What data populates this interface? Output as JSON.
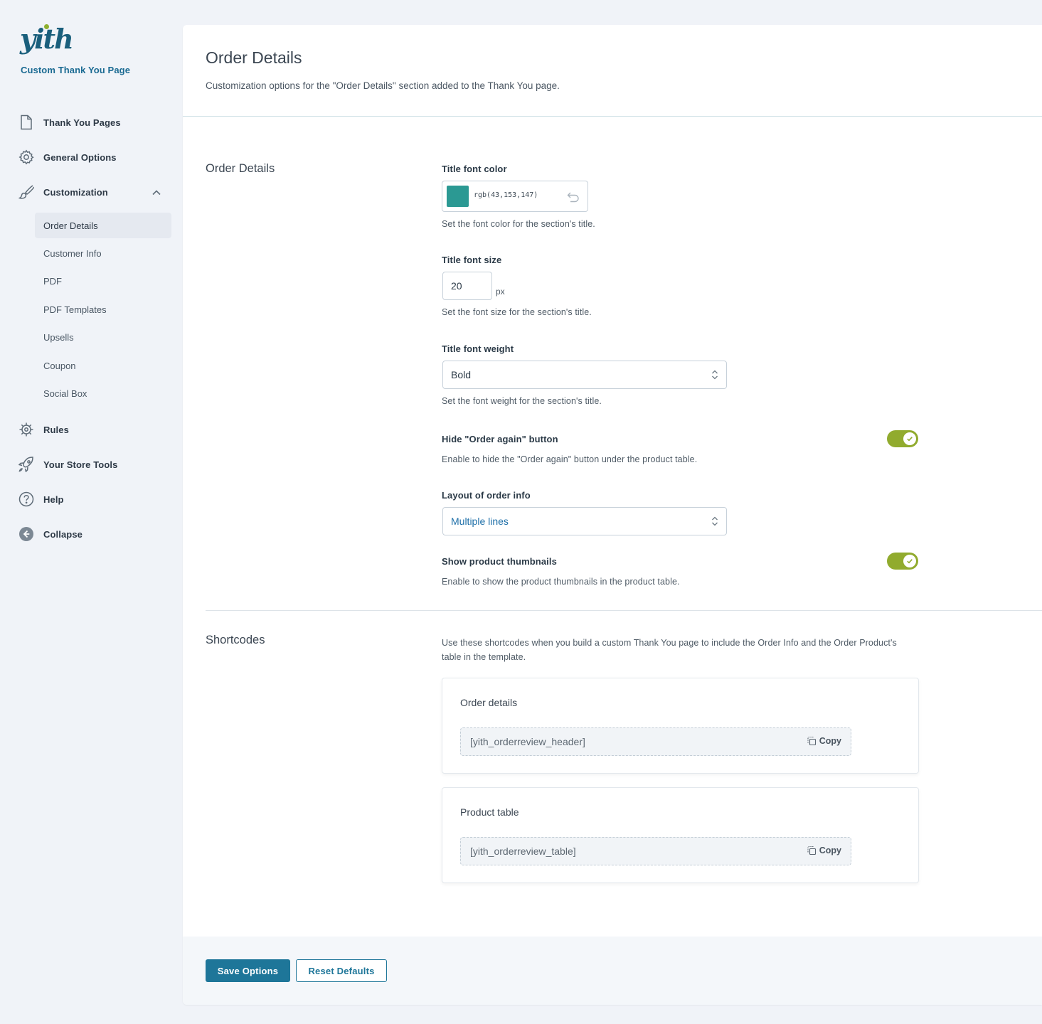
{
  "sidebar": {
    "logo_text": "yith",
    "plugin_name": "Custom Thank You Page",
    "items": [
      {
        "label": "Thank You Pages",
        "icon": "document-icon"
      },
      {
        "label": "General Options",
        "icon": "gear-icon"
      },
      {
        "label": "Customization",
        "icon": "brush-icon"
      },
      {
        "label": "Rules",
        "icon": "cog-rules-icon"
      },
      {
        "label": "Your Store Tools",
        "icon": "rocket-icon"
      },
      {
        "label": "Help",
        "icon": "help-icon"
      },
      {
        "label": "Collapse",
        "icon": "collapse-icon"
      }
    ],
    "subitems": [
      "Order Details",
      "Customer Info",
      "PDF",
      "PDF Templates",
      "Upsells",
      "Coupon",
      "Social Box"
    ],
    "active_subitem": "Order Details"
  },
  "page": {
    "title": "Order Details",
    "description": "Customization options for the \"Order Details\" section added to the Thank You page."
  },
  "order_details": {
    "section_title": "Order Details",
    "title_font_color": {
      "label": "Title font color",
      "value": "rgb(43,153,147)",
      "swatch": "#2b9993",
      "desc": "Set the font color for the section's title."
    },
    "title_font_size": {
      "label": "Title font size",
      "value": "20",
      "unit": "px",
      "desc": "Set the font size for the section's title."
    },
    "title_font_weight": {
      "label": "Title font weight",
      "value": "Bold",
      "desc": "Set the font weight for the section's title."
    },
    "hide_order_again": {
      "label": "Hide \"Order again\" button",
      "enabled": true,
      "desc": "Enable to hide the \"Order again\" button under the product table."
    },
    "layout_order_info": {
      "label": "Layout of order info",
      "value": "Multiple lines"
    },
    "show_thumbnails": {
      "label": "Show product thumbnails",
      "enabled": true,
      "desc": "Enable to show the product thumbnails in the product table."
    }
  },
  "shortcodes": {
    "section_title": "Shortcodes",
    "intro": "Use these shortcodes when you build a custom Thank You page to include the Order Info and the Order Product's table in the template.",
    "items": [
      {
        "title": "Order details",
        "code": "[yith_orderreview_header]",
        "copy_label": "Copy"
      },
      {
        "title": "Product table",
        "code": "[yith_orderreview_table]",
        "copy_label": "Copy"
      }
    ]
  },
  "footer": {
    "save_label": "Save Options",
    "reset_label": "Reset Defaults"
  },
  "colors": {
    "accent": "#1e7699",
    "toggle_on": "#91ab2e",
    "select_value_link": "#1e6fa8"
  }
}
